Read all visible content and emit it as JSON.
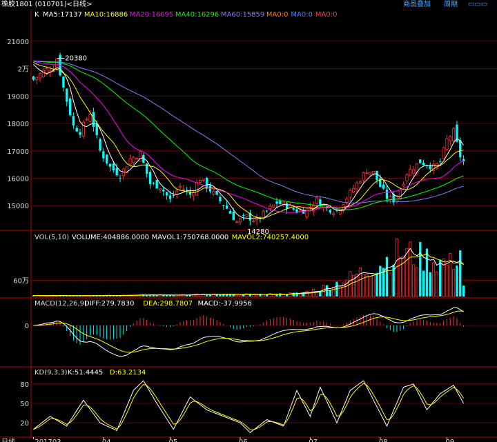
{
  "header": {
    "symbol": "橡胶1801 (010701)<日线>",
    "menu": [
      "商品叠加",
      "周期"
    ],
    "k_label": "K",
    "ma_labels": [
      {
        "text": "MA5:17137",
        "color": "#ffffff"
      },
      {
        "text": "MA10:16886",
        "color": "#ffff00"
      },
      {
        "text": "MA20:16695",
        "color": "#ff00ff"
      },
      {
        "text": "MA40:16296",
        "color": "#00ff00"
      },
      {
        "text": "MA60:15859",
        "color": "#8080ff"
      },
      {
        "text": "MA0:0",
        "color": "#ff8000"
      },
      {
        "text": "MA0:0",
        "color": "#4080ff"
      },
      {
        "text": "MA0:0",
        "color": "#ff4040"
      }
    ]
  },
  "colors": {
    "up": "#ff3232",
    "down": "#00ffff",
    "grid": "#800000",
    "axis": "#c00000"
  },
  "x_axis": {
    "label": "日线",
    "ticks": [
      "201703",
      "04",
      "05",
      "06",
      "07",
      "08",
      "09"
    ]
  },
  "price": {
    "ticks": [
      "21000",
      "2万",
      "19000",
      "18000",
      "17000",
      "16000",
      "15000"
    ],
    "tick_values": [
      21000,
      20000,
      19000,
      18000,
      17000,
      16000,
      15000
    ],
    "ylim": [
      14150,
      21700
    ],
    "high_label": "20380",
    "high_value": 20380,
    "high_index": 7,
    "low_label": "14280",
    "low_value": 14280,
    "low_index": 67
  },
  "volume": {
    "title": "VOL(5,10)",
    "labels": [
      {
        "text": "VOLUME:404886.0000",
        "color": "#ffffff"
      },
      {
        "text": "MAVOL1:750768.0000",
        "color": "#ffffff"
      },
      {
        "text": "MAVOL2:740257.4000",
        "color": "#ffff00"
      }
    ],
    "tick": "60万",
    "tick_value": 600000,
    "ylim": [
      0,
      2100000
    ]
  },
  "macd": {
    "title": "MACD(12,26,9)",
    "labels": [
      {
        "text": "DIFF:279.7830",
        "color": "#ffffff"
      },
      {
        "text": "DEA:298.7807",
        "color": "#ffff00"
      },
      {
        "text": "MACD:-37.9956",
        "color": "#ffffff"
      }
    ],
    "tick": "0"
  },
  "kd": {
    "title": "KD(9,3,3)",
    "labels": [
      {
        "text": "K:51.4445",
        "color": "#ffffff"
      },
      {
        "text": "D:63.2134",
        "color": "#ffff00"
      }
    ],
    "ticks": [
      "80",
      "50",
      "20"
    ],
    "tick_values": [
      80,
      50,
      20
    ],
    "ylim": [
      0,
      100
    ]
  },
  "chart_data": {
    "type": "candlestick",
    "title": "橡胶1801 (010701)<日线>",
    "series_count": 130,
    "price_keyframes": [
      [
        0,
        19600
      ],
      [
        3,
        19900
      ],
      [
        6,
        20050
      ],
      [
        7,
        20380
      ],
      [
        9,
        19300
      ],
      [
        12,
        17900
      ],
      [
        14,
        17700
      ],
      [
        17,
        18400
      ],
      [
        20,
        17000
      ],
      [
        23,
        16400
      ],
      [
        26,
        16100
      ],
      [
        29,
        16700
      ],
      [
        32,
        16900
      ],
      [
        35,
        15800
      ],
      [
        38,
        15700
      ],
      [
        41,
        15200
      ],
      [
        44,
        15700
      ],
      [
        47,
        15400
      ],
      [
        50,
        16000
      ],
      [
        52,
        15700
      ],
      [
        55,
        15300
      ],
      [
        58,
        14900
      ],
      [
        61,
        14400
      ],
      [
        64,
        14600
      ],
      [
        67,
        14450
      ],
      [
        70,
        14800
      ],
      [
        73,
        15100
      ],
      [
        76,
        15000
      ],
      [
        79,
        14800
      ],
      [
        82,
        14850
      ],
      [
        85,
        15200
      ],
      [
        88,
        14900
      ],
      [
        91,
        14800
      ],
      [
        94,
        15300
      ],
      [
        97,
        15800
      ],
      [
        100,
        16300
      ],
      [
        102,
        16200
      ],
      [
        104,
        15700
      ],
      [
        106,
        15300
      ],
      [
        108,
        15200
      ],
      [
        110,
        15600
      ],
      [
        112,
        16200
      ],
      [
        114,
        16400
      ],
      [
        116,
        16600
      ],
      [
        118,
        16500
      ],
      [
        120,
        16400
      ],
      [
        122,
        16600
      ],
      [
        124,
        17400
      ],
      [
        126,
        17700
      ],
      [
        128,
        16800
      ],
      [
        129,
        16600
      ]
    ],
    "volume_keyframes": [
      [
        0,
        30000
      ],
      [
        40,
        60000
      ],
      [
        70,
        80000
      ],
      [
        80,
        120000
      ],
      [
        85,
        250000
      ],
      [
        90,
        450000
      ],
      [
        95,
        700000
      ],
      [
        100,
        1000000
      ],
      [
        105,
        1300000
      ],
      [
        110,
        1650000
      ],
      [
        115,
        1500000
      ],
      [
        120,
        1350000
      ],
      [
        125,
        1200000
      ],
      [
        128,
        1700000
      ],
      [
        129,
        404886
      ]
    ],
    "kd_keyframes": [
      [
        0,
        10
      ],
      [
        5,
        30
      ],
      [
        10,
        15
      ],
      [
        15,
        55
      ],
      [
        20,
        20
      ],
      [
        25,
        8
      ],
      [
        30,
        70
      ],
      [
        33,
        85
      ],
      [
        37,
        50
      ],
      [
        42,
        10
      ],
      [
        47,
        60
      ],
      [
        52,
        40
      ],
      [
        57,
        30
      ],
      [
        62,
        20
      ],
      [
        65,
        5
      ],
      [
        70,
        25
      ],
      [
        75,
        15
      ],
      [
        79,
        70
      ],
      [
        83,
        30
      ],
      [
        86,
        75
      ],
      [
        91,
        20
      ],
      [
        95,
        70
      ],
      [
        99,
        85
      ],
      [
        103,
        45
      ],
      [
        106,
        15
      ],
      [
        111,
        75
      ],
      [
        114,
        80
      ],
      [
        118,
        40
      ],
      [
        122,
        65
      ],
      [
        126,
        78
      ],
      [
        129,
        50
      ]
    ]
  }
}
